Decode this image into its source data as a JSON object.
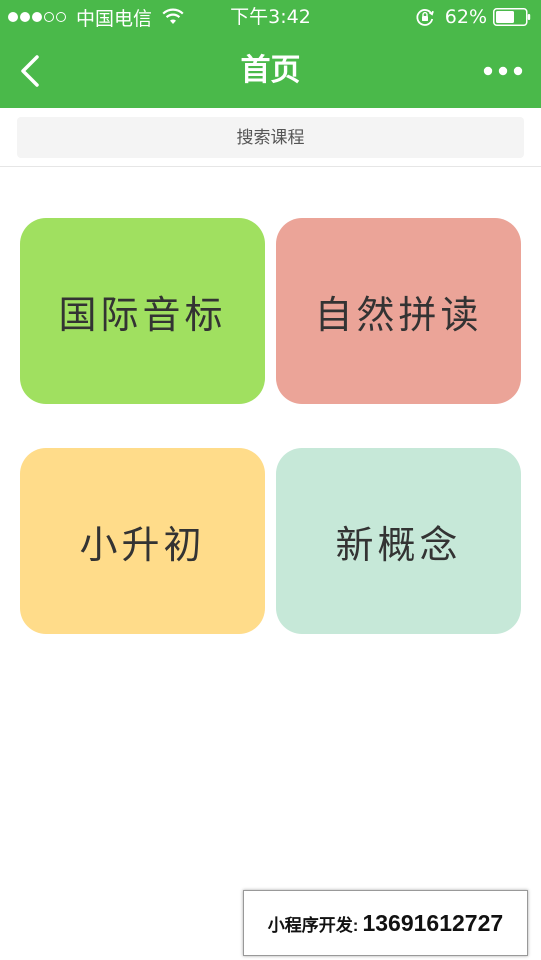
{
  "status_bar": {
    "carrier": "中国电信",
    "time": "下午3:42",
    "battery_percent": "62%",
    "battery_level": 0.62,
    "signal_bars_filled": 3,
    "signal_bars_total": 5
  },
  "nav": {
    "title": "首页",
    "back_icon": "chevron-left-icon",
    "more_icon": "more-dots-icon"
  },
  "search": {
    "placeholder": "搜索课程"
  },
  "cards": [
    {
      "label": "国际音标",
      "color": "#a0e060"
    },
    {
      "label": "自然拼读",
      "color": "#eba498"
    },
    {
      "label": "小升初",
      "color": "#ffdc8a"
    },
    {
      "label": "新概念",
      "color": "#c6e8d8"
    }
  ],
  "footer_box": {
    "label": "小程序开发:",
    "phone": "13691612727"
  },
  "colors": {
    "brand_green": "#4ab94a"
  }
}
